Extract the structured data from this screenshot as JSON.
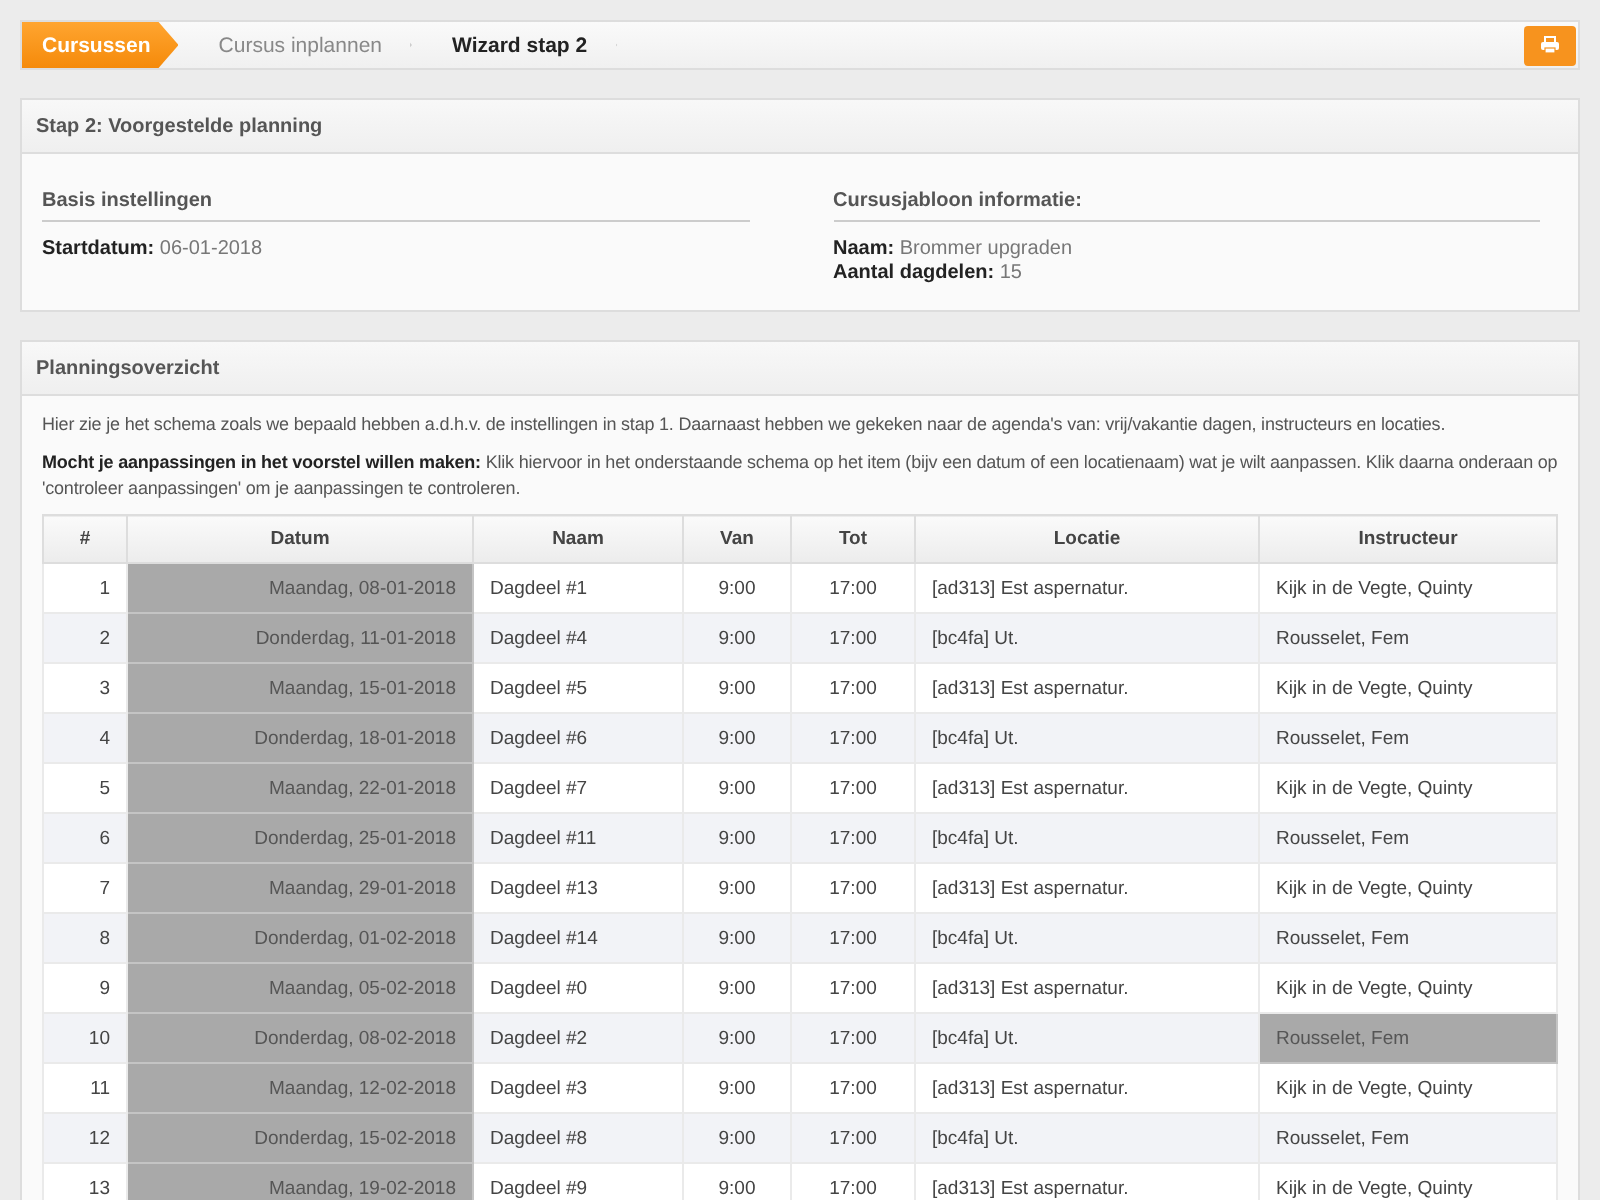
{
  "breadcrumb": [
    {
      "label": "Cursussen",
      "selected": true
    },
    {
      "label": "Cursus inplannen",
      "selected": false
    },
    {
      "label": "Wizard stap 2",
      "selected": false
    }
  ],
  "step_panel": {
    "title": "Stap 2: Voorgestelde planning",
    "sections": [
      {
        "heading": "Basis instellingen",
        "fields": [
          {
            "label": "Startdatum:",
            "value": "06-01-2018"
          }
        ]
      },
      {
        "heading": "Cursusjabloon informatie:",
        "fields": [
          {
            "label": "Naam:",
            "value": "Brommer upgraden"
          },
          {
            "label": "Aantal dagdelen:",
            "value": "15"
          }
        ]
      }
    ]
  },
  "overview_panel": {
    "title": "Planningsoverzicht",
    "intro": "Hier zie je het schema zoals we bepaald hebben a.d.h.v. de instellingen in stap 1. Daarnaast hebben we gekeken naar de agenda's van: vrij/vakantie dagen, instructeurs en locaties.",
    "instruction": "**Mocht je aanpassingen in het voorstel willen maken:** Klik hiervoor in het onderstaande schema op het item (bijv een datum of een locatienaam) wat je wilt aanpassen. Klik daarna onderaan op 'controleer aanpassingen' om je aanpassingen te controleren."
  },
  "table": {
    "columns": [
      "#",
      "Datum",
      "Naam",
      "Van",
      "Tot",
      "Locatie",
      "Instructeur"
    ],
    "rows": [
      {
        "nr": "1",
        "datum": "Maandag, 08-01-2018",
        "datum_flagged": true,
        "naam": "Dagdeel #1",
        "van": "9:00",
        "tot": "17:00",
        "locatie": "[ad313] Est aspernatur.",
        "locatie_flagged": false,
        "instructeur": "Kijk in de Vegte, Quinty",
        "instructeur_flagged": false
      },
      {
        "nr": "2",
        "datum": "Donderdag, 11-01-2018",
        "datum_flagged": true,
        "naam": "Dagdeel #4",
        "van": "9:00",
        "tot": "17:00",
        "locatie": "[bc4fa] Ut.",
        "locatie_flagged": false,
        "instructeur": "Rousselet, Fem",
        "instructeur_flagged": false
      },
      {
        "nr": "3",
        "datum": "Maandag, 15-01-2018",
        "datum_flagged": true,
        "naam": "Dagdeel #5",
        "van": "9:00",
        "tot": "17:00",
        "locatie": "[ad313] Est aspernatur.",
        "locatie_flagged": false,
        "instructeur": "Kijk in de Vegte, Quinty",
        "instructeur_flagged": false
      },
      {
        "nr": "4",
        "datum": "Donderdag, 18-01-2018",
        "datum_flagged": true,
        "naam": "Dagdeel #6",
        "van": "9:00",
        "tot": "17:00",
        "locatie": "[bc4fa] Ut.",
        "locatie_flagged": false,
        "instructeur": "Rousselet, Fem",
        "instructeur_flagged": false
      },
      {
        "nr": "5",
        "datum": "Maandag, 22-01-2018",
        "datum_flagged": true,
        "naam": "Dagdeel #7",
        "van": "9:00",
        "tot": "17:00",
        "locatie": "[ad313] Est aspernatur.",
        "locatie_flagged": false,
        "instructeur": "Kijk in de Vegte, Quinty",
        "instructeur_flagged": false
      },
      {
        "nr": "6",
        "datum": "Donderdag, 25-01-2018",
        "datum_flagged": true,
        "naam": "Dagdeel #11",
        "van": "9:00",
        "tot": "17:00",
        "locatie": "[bc4fa] Ut.",
        "locatie_flagged": false,
        "instructeur": "Rousselet, Fem",
        "instructeur_flagged": false
      },
      {
        "nr": "7",
        "datum": "Maandag, 29-01-2018",
        "datum_flagged": true,
        "naam": "Dagdeel #13",
        "van": "9:00",
        "tot": "17:00",
        "locatie": "[ad313] Est aspernatur.",
        "locatie_flagged": false,
        "instructeur": "Kijk in de Vegte, Quinty",
        "instructeur_flagged": false
      },
      {
        "nr": "8",
        "datum": "Donderdag, 01-02-2018",
        "datum_flagged": true,
        "naam": "Dagdeel #14",
        "van": "9:00",
        "tot": "17:00",
        "locatie": "[bc4fa] Ut.",
        "locatie_flagged": false,
        "instructeur": "Rousselet, Fem",
        "instructeur_flagged": false
      },
      {
        "nr": "9",
        "datum": "Maandag, 05-02-2018",
        "datum_flagged": true,
        "naam": "Dagdeel #0",
        "van": "9:00",
        "tot": "17:00",
        "locatie": "[ad313] Est aspernatur.",
        "locatie_flagged": false,
        "instructeur": "Kijk in de Vegte, Quinty",
        "instructeur_flagged": false
      },
      {
        "nr": "10",
        "datum": "Donderdag, 08-02-2018",
        "datum_flagged": true,
        "naam": "Dagdeel #2",
        "van": "9:00",
        "tot": "17:00",
        "locatie": "[bc4fa] Ut.",
        "locatie_flagged": false,
        "instructeur": "Rousselet, Fem",
        "instructeur_flagged": true
      },
      {
        "nr": "11",
        "datum": "Maandag, 12-02-2018",
        "datum_flagged": true,
        "naam": "Dagdeel #3",
        "van": "9:00",
        "tot": "17:00",
        "locatie": "[ad313] Est aspernatur.",
        "locatie_flagged": false,
        "instructeur": "Kijk in de Vegte, Quinty",
        "instructeur_flagged": false
      },
      {
        "nr": "12",
        "datum": "Donderdag, 15-02-2018",
        "datum_flagged": true,
        "naam": "Dagdeel #8",
        "van": "9:00",
        "tot": "17:00",
        "locatie": "[bc4fa] Ut.",
        "locatie_flagged": false,
        "instructeur": "Rousselet, Fem",
        "instructeur_flagged": false
      },
      {
        "nr": "13",
        "datum": "Maandag, 19-02-2018",
        "datum_flagged": true,
        "naam": "Dagdeel #9",
        "van": "9:00",
        "tot": "17:00",
        "locatie": "[ad313] Est aspernatur.",
        "locatie_flagged": false,
        "instructeur": "Kijk in de Vegte, Quinty",
        "instructeur_flagged": false
      }
    ]
  }
}
